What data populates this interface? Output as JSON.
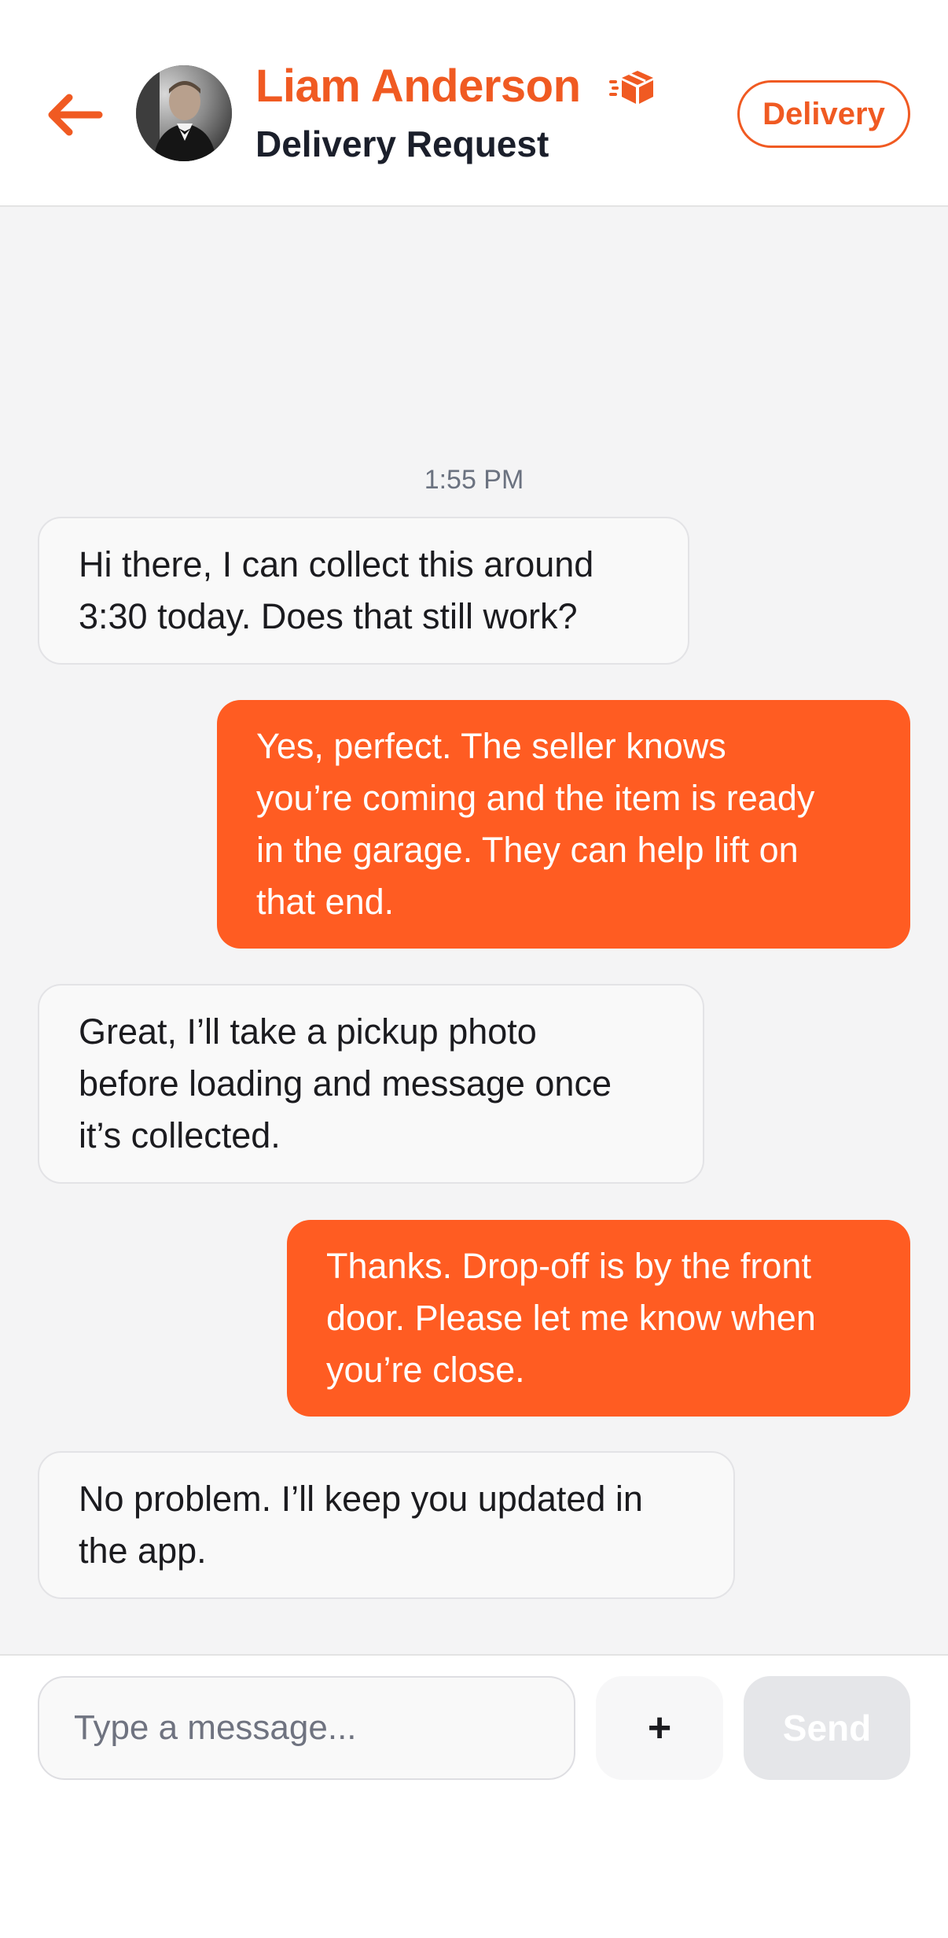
{
  "header": {
    "name": "Liam Anderson",
    "subtitle": "Delivery Request",
    "badge": "Delivery",
    "icons": [
      "back-arrow-icon",
      "avatar",
      "package-icon"
    ]
  },
  "chat": {
    "timestamp": "1:55 PM",
    "messages": [
      {
        "direction": "incoming",
        "lines": [
          "Hi there, I can collect this around",
          "3:30 today. Does that still work?"
        ]
      },
      {
        "direction": "outgoing",
        "lines": [
          "Yes, perfect. The seller knows",
          "you’re coming and the item is ready",
          "in the garage. They can help lift on",
          "that end."
        ]
      },
      {
        "direction": "incoming",
        "lines": [
          "Great, I’ll take a pickup photo",
          "before loading and message once",
          "it’s collected."
        ]
      },
      {
        "direction": "outgoing",
        "lines": [
          "Thanks. Drop-off is by the front",
          "door. Please let me know when",
          "you’re close."
        ]
      },
      {
        "direction": "incoming",
        "lines": [
          "No problem. I’ll keep you updated in",
          "the app."
        ]
      }
    ]
  },
  "composer": {
    "placeholder": "Type a message...",
    "value": "",
    "plus_label": "+",
    "send_label": "Send"
  },
  "colors": {
    "accent": "#f05a22",
    "outgoing_bubble": "#ff5c22",
    "incoming_bubble": "#f9f9f9",
    "chat_background": "#f4f4f5",
    "send_disabled": "#e5e6e9"
  }
}
